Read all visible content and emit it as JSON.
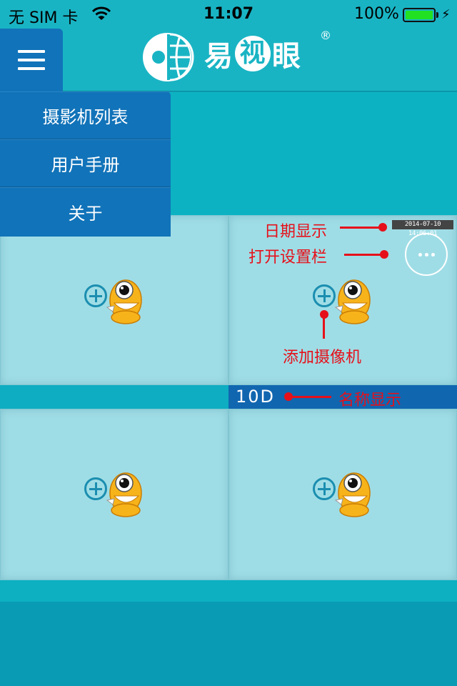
{
  "status_bar": {
    "carrier": "无 SIM 卡",
    "time": "11:07",
    "battery_percent": "100%",
    "icons": [
      "wifi-icon",
      "battery-icon",
      "charging-icon"
    ]
  },
  "header": {
    "logo_text": "易",
    "logo_circle_text": "视",
    "logo_text_tail": "眼",
    "logo_reg": "®",
    "menu_icon": "hamburger-icon"
  },
  "menu": {
    "items": [
      {
        "label": "摄影机列表"
      },
      {
        "label": "用户手册"
      },
      {
        "label": "关于"
      }
    ]
  },
  "grid": {
    "camera_name": "10D",
    "timestamp": "2014-07-10 14:06:01",
    "add_icon": "add-camera-icon",
    "more_icon": "more-icon"
  },
  "annotations": {
    "date": "日期显示",
    "settings": "打开设置栏",
    "add_camera": "添加摄像机",
    "name": "名称显示"
  },
  "colors": {
    "teal": "#19b4c4",
    "blue": "#1173b9",
    "annotation_red": "#e6101a"
  }
}
